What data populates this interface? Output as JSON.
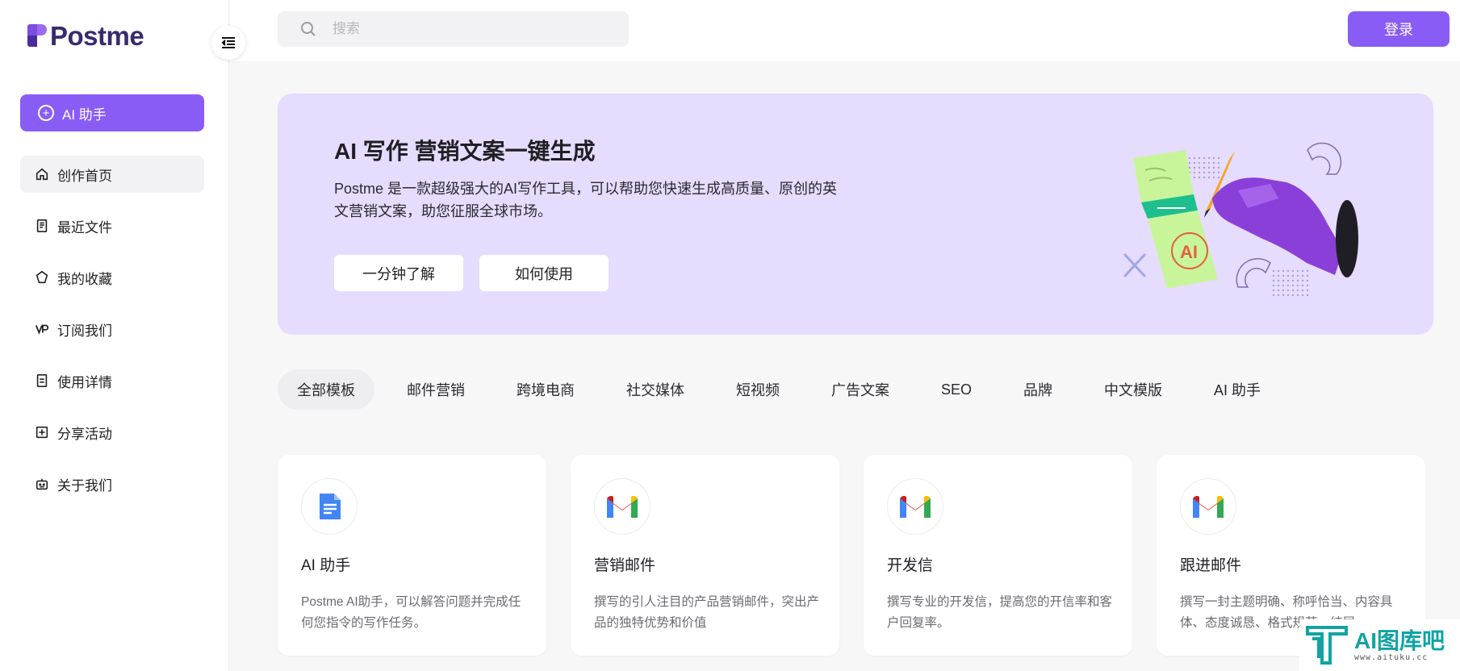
{
  "brand": {
    "name": "Postme"
  },
  "sidebar": {
    "ai_button": "AI 助手",
    "items": [
      {
        "label": "创作首页",
        "icon": "home-icon",
        "active": true
      },
      {
        "label": "最近文件",
        "icon": "document-icon",
        "active": false
      },
      {
        "label": "我的收藏",
        "icon": "star-icon",
        "active": false
      },
      {
        "label": "订阅我们",
        "icon": "vip-icon",
        "active": false
      },
      {
        "label": "使用详情",
        "icon": "list-icon",
        "active": false
      },
      {
        "label": "分享活动",
        "icon": "share-plus-icon",
        "active": false
      },
      {
        "label": "关于我们",
        "icon": "robot-icon",
        "active": false
      }
    ]
  },
  "header": {
    "search_placeholder": "搜索",
    "login_label": "登录"
  },
  "banner": {
    "title": "AI 写作 营销文案一键生成",
    "description": "Postme 是一款超级强大的AI写作工具，可以帮助您快速生成高质量、原创的英文营销文案，助您征服全球市场。",
    "button_1": "一分钟了解",
    "button_2": "如何使用"
  },
  "tabs": [
    {
      "label": "全部模板",
      "active": true
    },
    {
      "label": "邮件营销",
      "active": false
    },
    {
      "label": "跨境电商",
      "active": false
    },
    {
      "label": "社交媒体",
      "active": false
    },
    {
      "label": "短视频",
      "active": false
    },
    {
      "label": "广告文案",
      "active": false
    },
    {
      "label": "SEO",
      "active": false
    },
    {
      "label": "品牌",
      "active": false
    },
    {
      "label": "中文模版",
      "active": false
    },
    {
      "label": "AI 助手",
      "active": false
    }
  ],
  "cards": [
    {
      "title": "AI 助手",
      "desc": "Postme AI助手，可以解答问题并完成任何您指令的写作任务。",
      "icon": "google-docs-icon"
    },
    {
      "title": "营销邮件",
      "desc": "撰写的引人注目的产品营销邮件，突出产品的独特优势和价值",
      "icon": "gmail-icon"
    },
    {
      "title": "开发信",
      "desc": "撰写专业的开发信，提高您的开信率和客户回复率。",
      "icon": "gmail-icon"
    },
    {
      "title": "跟进邮件",
      "desc": "撰写一封主题明确、称呼恰当、内容具体、态度诚恳、格式规范、结尾",
      "icon": "gmail-icon"
    }
  ],
  "watermark": {
    "main": "AI图库吧",
    "sub": "www.aituku.cc"
  },
  "colors": {
    "accent": "#8a5cf6",
    "banner_bg": "#e6dcfd"
  }
}
